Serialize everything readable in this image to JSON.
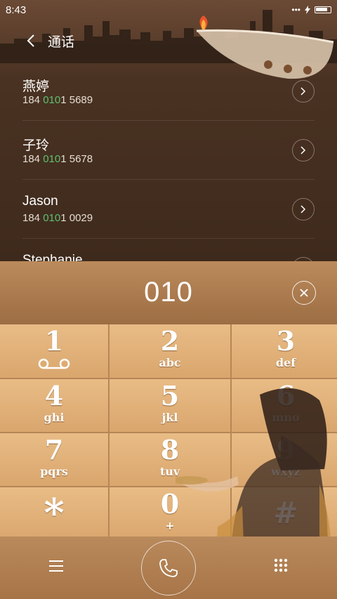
{
  "status_bar": {
    "time": "8:43",
    "signal": "•••"
  },
  "header": {
    "back_icon": "chevron-left-icon",
    "title": "通话"
  },
  "contacts": [
    {
      "name": "燕婷",
      "number_prefix": "184 ",
      "number_match": "010",
      "number_suffix": "1 5689"
    },
    {
      "name": "子玲",
      "number_prefix": "184 ",
      "number_match": "010",
      "number_suffix": "1 5678"
    },
    {
      "name": "Jason",
      "number_prefix": "184 ",
      "number_match": "010",
      "number_suffix": "1 0029"
    },
    {
      "name": "Stephanie",
      "number_prefix": "",
      "number_match": "",
      "number_suffix": ""
    }
  ],
  "dialer": {
    "input_value": "010",
    "clear_icon": "close-icon"
  },
  "keypad": [
    {
      "digit": "1",
      "letters": ""
    },
    {
      "digit": "2",
      "letters": "abc"
    },
    {
      "digit": "3",
      "letters": "def"
    },
    {
      "digit": "4",
      "letters": "ghi"
    },
    {
      "digit": "5",
      "letters": "jkl"
    },
    {
      "digit": "6",
      "letters": "mno"
    },
    {
      "digit": "7",
      "letters": "pqrs"
    },
    {
      "digit": "8",
      "letters": "tuv"
    },
    {
      "digit": "9",
      "letters": "wxyz"
    },
    {
      "digit": "*",
      "letters": ""
    },
    {
      "digit": "0",
      "letters": "+"
    },
    {
      "digit": "#",
      "letters": ""
    }
  ],
  "bottom_bar": {
    "menu_icon": "menu-icon",
    "call_icon": "phone-icon",
    "dialpad_icon": "dialpad-icon"
  },
  "colors": {
    "match_highlight": "#5cc071",
    "key_face": "#e2b17a",
    "list_background": "#3f2a1c"
  }
}
